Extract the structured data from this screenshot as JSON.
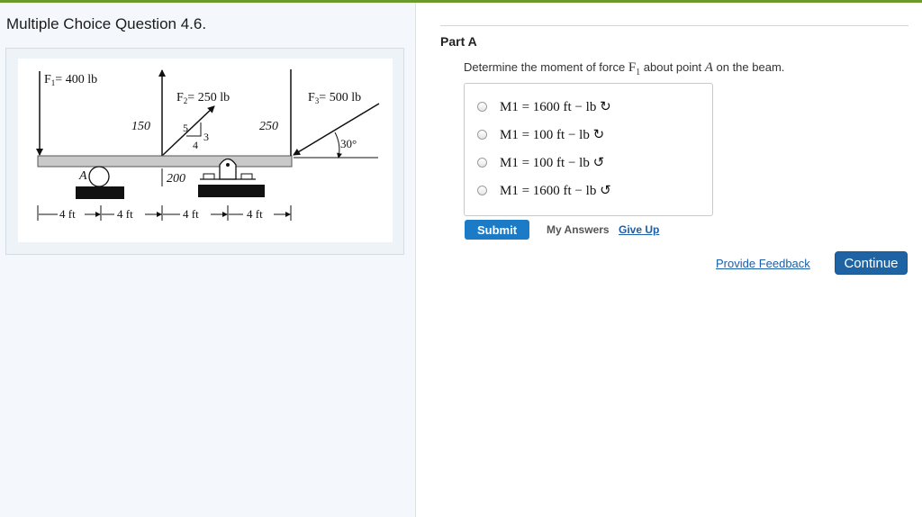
{
  "question": {
    "title": "Multiple Choice Question 4.6."
  },
  "figure": {
    "f1_label": "F",
    "f1_sub": "1",
    "f1_value": "= 400 lb",
    "f2_label": "F",
    "f2_sub": "2",
    "f2_value": "= 250 lb",
    "f3_label": "F",
    "f3_sub": "3",
    "f3_value": "= 500 lb",
    "dim_150": "150",
    "dim_250": "250",
    "dim_200": "200",
    "triangle_5": "5",
    "triangle_3": "3",
    "triangle_4": "4",
    "angle": "30°",
    "point_a": "A",
    "span_labels": [
      "4 ft",
      "4 ft",
      "4 ft",
      "4 ft"
    ]
  },
  "part": {
    "label": "Part A",
    "prompt_before": "Determine the moment of force ",
    "prompt_force": "F",
    "prompt_force_sub": "1",
    "prompt_mid": " about point ",
    "prompt_point": "A",
    "prompt_after": " on the beam."
  },
  "choices": [
    {
      "text": "M1 = 1600 ft − lb ↻"
    },
    {
      "text": "M1 = 100 ft − lb ↻"
    },
    {
      "text": "M1 = 100 ft − lb ↺"
    },
    {
      "text": "M1 = 1600 ft − lb ↺"
    }
  ],
  "actions": {
    "submit": "Submit",
    "my_answers": "My Answers",
    "give_up": "Give Up",
    "provide_feedback": "Provide Feedback",
    "continue": "Continue"
  },
  "colors": {
    "top_bar": "#6a9a2c",
    "submit_bg": "#1c7bc7",
    "continue_bg": "#1e64a4",
    "link": "#1a5fa8"
  }
}
